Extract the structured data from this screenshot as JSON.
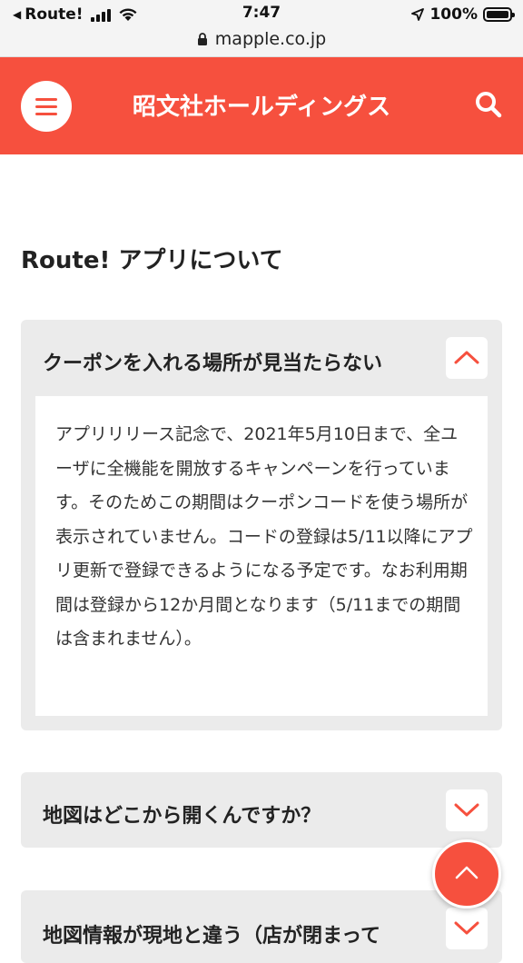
{
  "status_bar": {
    "back_app": "Route!",
    "time": "7:47",
    "battery": "100%",
    "url": "mapple.co.jp"
  },
  "header": {
    "title": "昭文社ホールディングス"
  },
  "section": {
    "title": "Route! アプリについて"
  },
  "faqs": [
    {
      "question": "クーポンを入れる場所が見当たらない",
      "expanded": true,
      "answer": "アプリリリース記念で、2021年5月10日まで、全ユーザに全機能を開放するキャンペーンを行っています。そのためこの期間はクーポンコードを使う場所が表示されていません。コードの登録は5/11以降にアプリ更新で登録できるようになる予定です。なお利用期間は登録から12か月間となります（5/11までの期間は含まれません）。"
    },
    {
      "question": "地図はどこから開くんですか？",
      "expanded": false
    },
    {
      "question": "地図情報が現地と違う（店が閉まって",
      "expanded": false
    }
  ],
  "colors": {
    "brand": "#f6503e",
    "card_bg": "#ebebeb"
  },
  "icons": {
    "menu": "hamburger-icon",
    "search": "search-icon",
    "collapse": "chevron-up-icon",
    "expand": "chevron-down-icon",
    "scroll_top": "chevron-up-icon"
  }
}
